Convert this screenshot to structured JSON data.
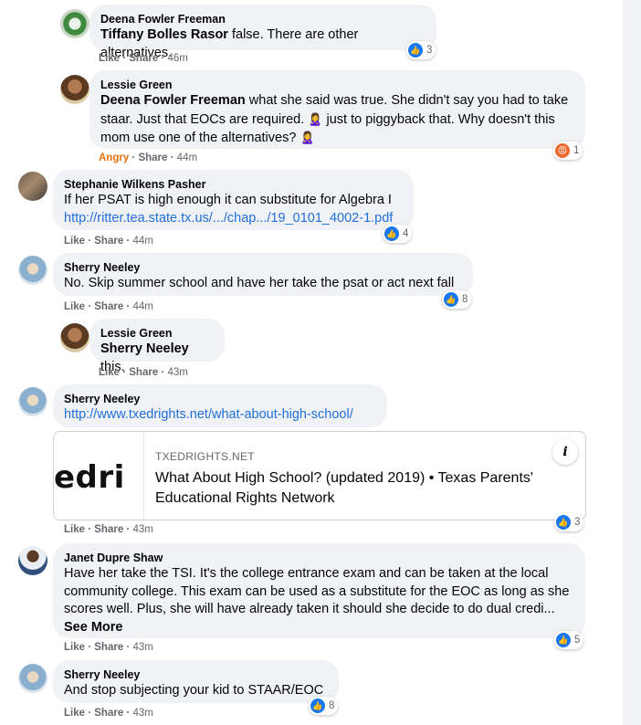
{
  "comments": [
    {
      "author": "Deena Fowler Freeman",
      "mention": "Tiffany Bolles Rasor",
      "text": " false. There are other alternatives.",
      "actions": {
        "like": "Like",
        "share": "Share",
        "time": "46m"
      },
      "reaction_count": "3"
    },
    {
      "author": "Lessie Green",
      "mention": "Deena Fowler Freeman",
      "text_1": " what she said was true. She didn't say you had to take staar. Just that EOCs are required.",
      "text_2": " just to piggyback that. Why doesn't this mom use one of the alternatives?",
      "emoji": "🙎‍♀️",
      "actions": {
        "angry": "Angry",
        "share": "Share",
        "time": "44m"
      },
      "reaction_count": "1"
    },
    {
      "author": "Stephanie Wilkens Pasher",
      "text": "If her PSAT is high enough it can substitute for Algebra I",
      "link": "http://ritter.tea.state.tx.us/.../chap.../19_0101_4002-1.pdf",
      "actions": {
        "like": "Like",
        "share": "Share",
        "time": "44m"
      },
      "reaction_count": "4"
    },
    {
      "author": "Sherry Neeley",
      "text": "No. Skip summer school and have her take the psat or act next fall",
      "actions": {
        "like": "Like",
        "share": "Share",
        "time": "44m"
      },
      "reaction_count": "8"
    },
    {
      "author": "Lessie Green",
      "mention": "Sherry Neeley",
      "text": " this.",
      "actions": {
        "like": "Like",
        "share": "Share",
        "time": "43m"
      }
    },
    {
      "author": "Sherry Neeley",
      "link": "http://www.txedrights.net/what-about-high-school/",
      "card": {
        "thumb_text": "edri",
        "domain": "TXEDRIGHTS.NET",
        "title": "What About High School? (updated 2019) • Texas Parents' Educational Rights Network",
        "info": "i"
      },
      "actions": {
        "like": "Like",
        "share": "Share",
        "time": "43m"
      },
      "reaction_count": "3"
    },
    {
      "author": "Janet Dupre Shaw",
      "text": "Have her take the TSI. It's the college entrance exam and can be taken at the local community college. This exam can be used as a substitute for the EOC as long as she scores well. Plus, she will have already taken it should she decide to do dual credi...",
      "see_more": "See More",
      "actions": {
        "like": "Like",
        "share": "Share",
        "time": "43m"
      },
      "reaction_count": "5"
    },
    {
      "author": "Sherry Neeley",
      "text": "And stop subjecting your kid to STAAR/EOC",
      "actions": {
        "like": "Like",
        "share": "Share",
        "time": "43m"
      },
      "reaction_count": "8"
    }
  ],
  "colors": {
    "bubble": "#f0f2f5",
    "link": "#216fdb",
    "meta": "#65676b",
    "like": "#1877f2",
    "angry": "#e9710f"
  },
  "icons": {
    "like_reaction": "thumbs-up-icon",
    "angry_reaction": "angry-face-icon",
    "info": "info-icon"
  }
}
